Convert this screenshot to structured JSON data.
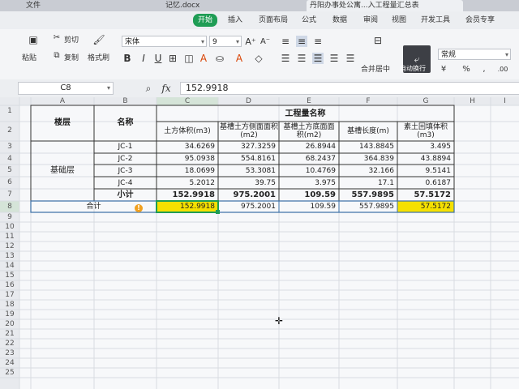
{
  "tabs": [
    {
      "label": "文件",
      "icon": "menu-icon"
    },
    {
      "label": "记忆.docx"
    },
    {
      "label": "丹阳办事处公寓...入工程量汇总表"
    }
  ],
  "menu": [
    "开始",
    "插入",
    "页面布局",
    "公式",
    "数据",
    "审阅",
    "视图",
    "开发工具",
    "会员专享"
  ],
  "menu_active": "开始",
  "ribbon": {
    "paste": "粘贴",
    "cut": "剪切",
    "copy": "复制",
    "format_painter": "格式刷",
    "font_name": "宋体",
    "font_size": "9",
    "merge_center": "合并居中",
    "wrap_text": "自动换行",
    "number_format": "常规"
  },
  "formula_bar": {
    "name_box": "C8",
    "fx": "fx",
    "value": "152.9918"
  },
  "columns": [
    "A",
    "B",
    "C",
    "D",
    "E",
    "F",
    "G",
    "H",
    "I"
  ],
  "rows": [
    "1",
    "2",
    "3",
    "4",
    "5",
    "6",
    "7",
    "8",
    "9",
    "10",
    "11",
    "12",
    "13",
    "14",
    "15",
    "16",
    "17",
    "18",
    "19",
    "20",
    "21",
    "22",
    "23",
    "24",
    "25"
  ],
  "table": {
    "floor_header": "楼层",
    "name_header": "名称",
    "group_header": "工程量名称",
    "sub_headers": [
      "土方体积(m3)",
      "基槽土方侧面面积(m2)",
      "基槽土方底面面积(m2)",
      "基槽长度(m)",
      "素土回填体积(m3)"
    ],
    "floor": "基础层",
    "rows": [
      {
        "name": "JC-1",
        "values": [
          "34.6269",
          "327.3259",
          "26.8944",
          "143.8845",
          "3.495"
        ]
      },
      {
        "name": "JC-2",
        "values": [
          "95.0938",
          "554.8161",
          "68.2437",
          "364.839",
          "43.8894"
        ]
      },
      {
        "name": "JC-3",
        "values": [
          "18.0699",
          "53.3081",
          "10.4769",
          "32.166",
          "9.5141"
        ]
      },
      {
        "name": "JC-4",
        "values": [
          "5.2012",
          "39.75",
          "3.975",
          "17.1",
          "0.6187"
        ]
      }
    ],
    "subtotal_label": "小计",
    "subtotal": [
      "152.9918",
      "975.2001",
      "109.59",
      "557.9895",
      "57.5172"
    ],
    "total_label": "合计",
    "total": [
      "152.9918",
      "975.2001",
      "109.59",
      "557.9895",
      "57.5172"
    ]
  },
  "colors": {
    "accent": "#1f9d55",
    "highlight": "#f5e000"
  }
}
